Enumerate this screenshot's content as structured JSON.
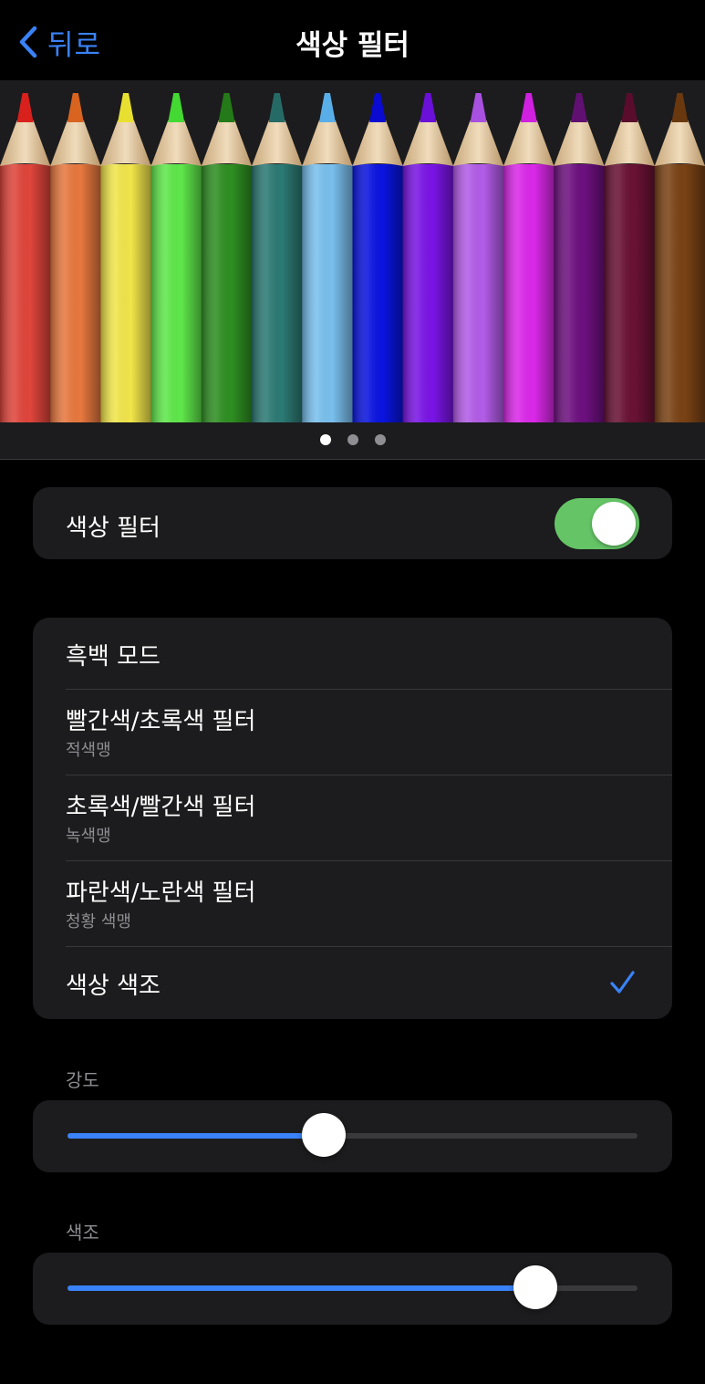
{
  "nav": {
    "back_label": "뒤로",
    "title": "색상 필터"
  },
  "preview": {
    "pencil_colors": [
      "#e0453b",
      "#e8783e",
      "#f2e64a",
      "#5fe84a",
      "#2e8f22",
      "#2c7a74",
      "#79c0ee",
      "#0a14e0",
      "#7a14e6",
      "#b35ce8",
      "#dc28ea",
      "#6e1080",
      "#6a1234",
      "#7a4214"
    ],
    "pencil_tip_colors": [
      "#d8201c",
      "#d86420",
      "#e8e030",
      "#44d832",
      "#247a18",
      "#266a66",
      "#5aaee8",
      "#0a0ad0",
      "#6a10d8",
      "#a850e0",
      "#d020e0",
      "#601070",
      "#5a0c2c",
      "#6a380e"
    ],
    "page_count": 3,
    "current_page": 1
  },
  "toggle": {
    "label": "색상 필터",
    "on": true,
    "on_color": "#65c466"
  },
  "filters": {
    "options": [
      {
        "title": "흑백 모드",
        "subtitle": "",
        "selected": false
      },
      {
        "title": "빨간색/초록색 필터",
        "subtitle": "적색맹",
        "selected": false
      },
      {
        "title": "초록색/빨간색 필터",
        "subtitle": "녹색맹",
        "selected": false
      },
      {
        "title": "파란색/노란색 필터",
        "subtitle": "청황 색맹",
        "selected": false
      },
      {
        "title": "색상 색조",
        "subtitle": "",
        "selected": true
      }
    ]
  },
  "intensity": {
    "label": "강도",
    "value": 0.45
  },
  "hue": {
    "label": "색조",
    "value": 0.82
  },
  "colors": {
    "accent": "#3a82f7",
    "background": "#000000",
    "card": "#1c1c1e"
  }
}
